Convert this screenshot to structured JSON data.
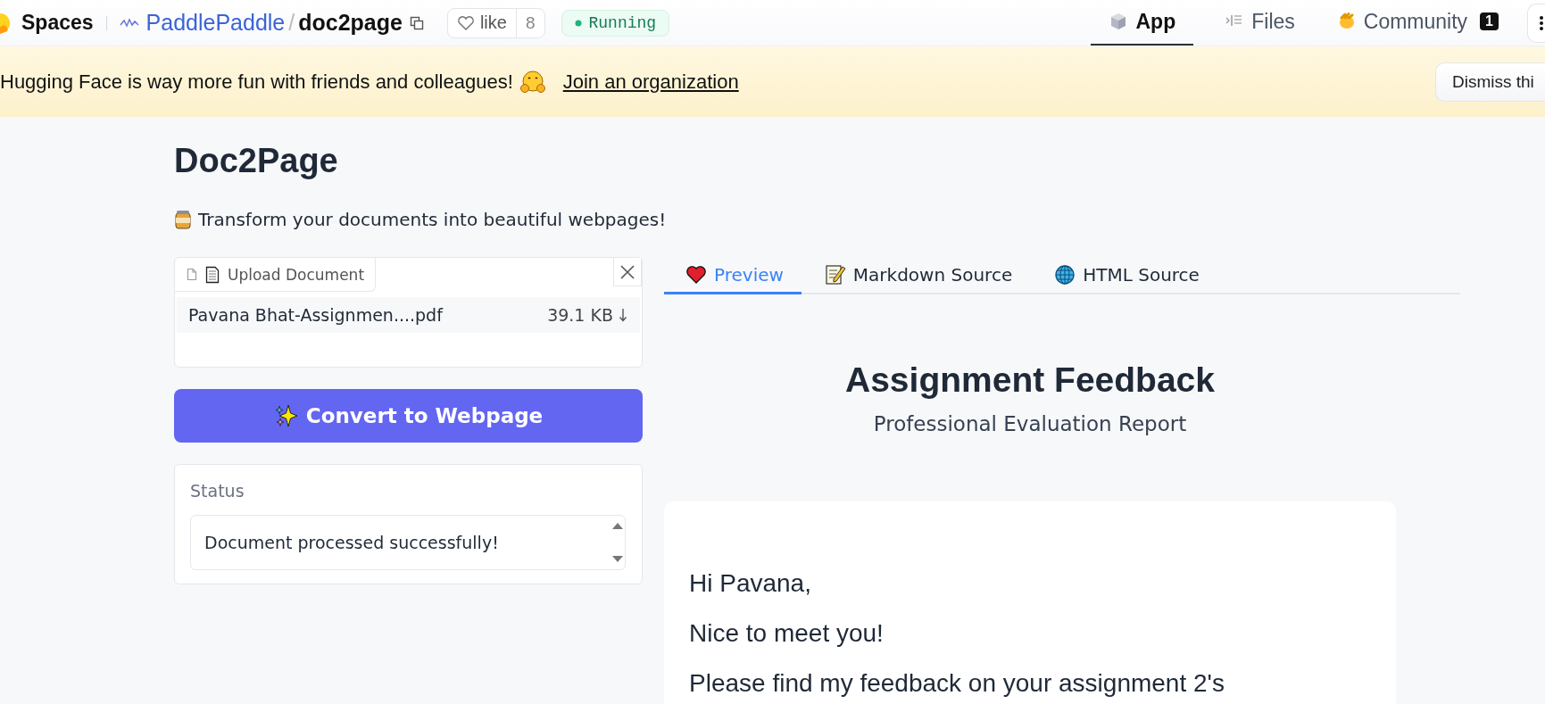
{
  "header": {
    "brand": "Spaces",
    "owner": "PaddlePaddle",
    "separator": "/",
    "repo": "doc2page",
    "like_label": "like",
    "like_count": "8",
    "status": "Running",
    "tabs": [
      {
        "kind": "app",
        "label": "App",
        "selected": true
      },
      {
        "kind": "files",
        "label": "Files",
        "selected": false
      },
      {
        "kind": "community",
        "label": "Community",
        "badge": "1",
        "selected": false
      }
    ]
  },
  "banner": {
    "message": "Hugging Face is way more fun with friends and colleagues!",
    "link": "Join an organization",
    "dismiss": "Dismiss thi"
  },
  "app": {
    "title": "Doc2Page",
    "subtitle": "Transform your documents into beautiful webpages!",
    "upload": {
      "label": "Upload Document",
      "file_name": "Pavana Bhat-Assignmen....pdf",
      "file_size": "39.1 KB"
    },
    "convert_button": "Convert to Webpage",
    "status": {
      "label": "Status",
      "value": "Document processed successfully!"
    },
    "output_tabs": [
      {
        "kind": "heart",
        "label": "Preview",
        "selected": true
      },
      {
        "kind": "memo",
        "label": "Markdown Source",
        "selected": false
      },
      {
        "kind": "globe",
        "label": "HTML Source",
        "selected": false
      }
    ],
    "preview": {
      "heading": "Assignment Feedback",
      "subheading": "Professional Evaluation Report",
      "paragraphs": [
        "Hi Pavana,",
        "Nice to meet you!",
        "Please find my feedback on your assignment 2's"
      ]
    }
  }
}
